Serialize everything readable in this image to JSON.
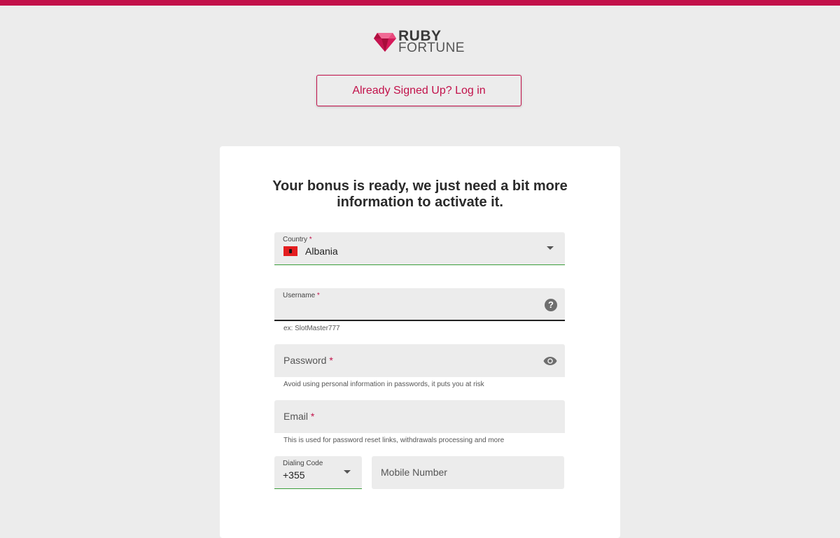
{
  "brand": {
    "line1": "RUBY",
    "line2": "FORTUNE",
    "color": "#c2114a"
  },
  "login_button": "Already Signed Up? Log in",
  "form": {
    "heading_line1": "Your bonus is ready, we just need a bit more",
    "heading_line2": "information to activate it.",
    "required_mark": "*",
    "country": {
      "label": "Country",
      "value": "Albania",
      "icon": "albania-flag-icon"
    },
    "username": {
      "label": "Username",
      "helper": "ex: SlotMaster777",
      "icon": "help-icon"
    },
    "password": {
      "placeholder": "Password",
      "helper": "Avoid using personal information in passwords, it puts you at risk",
      "icon": "eye-icon"
    },
    "email": {
      "placeholder": "Email",
      "helper": "This is used for password reset links, withdrawals processing and more"
    },
    "dialing_code": {
      "label": "Dialing Code",
      "value": "+355"
    },
    "mobile": {
      "placeholder": "Mobile Number"
    }
  }
}
